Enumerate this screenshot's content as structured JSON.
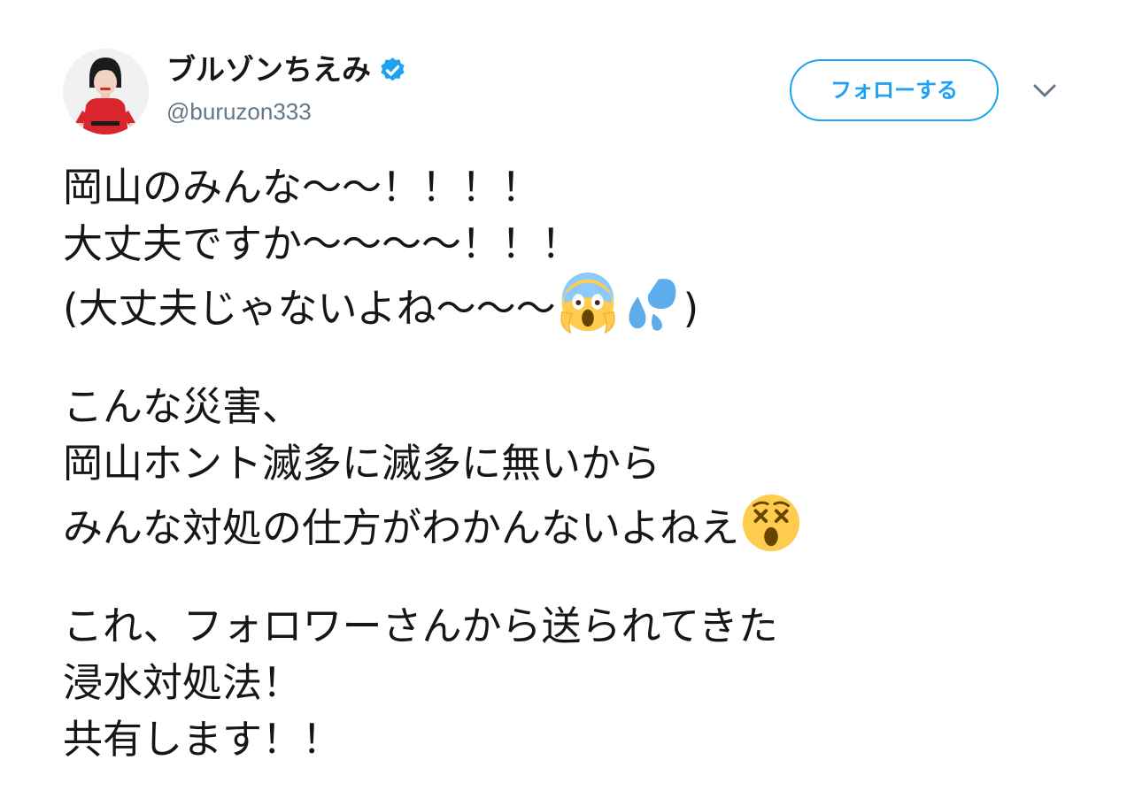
{
  "user": {
    "display_name": "ブルゾンちえみ",
    "handle": "@buruzon333",
    "verified": true
  },
  "actions": {
    "follow_label": "フォローする",
    "menu_icon": "chevron-down-icon"
  },
  "tweet": {
    "lines": [
      "岡山のみんな〜〜！！！！",
      "大丈夫ですか〜〜〜〜！！！",
      "(大丈夫じゃないよね〜〜〜",
      ")",
      "こんな災害、",
      "岡山ホント滅多に滅多に無いから",
      "みんな対処の仕方がわかんないよねえ",
      "これ、フォロワーさんから送られてきた",
      "浸水対処法！",
      "共有します！！"
    ],
    "emojis": [
      "face-screaming-in-fear-icon",
      "sweat-droplets-icon",
      "dizzy-face-icon"
    ]
  },
  "colors": {
    "accent": "#1da1f2",
    "text": "#14171a",
    "secondary": "#657786"
  }
}
